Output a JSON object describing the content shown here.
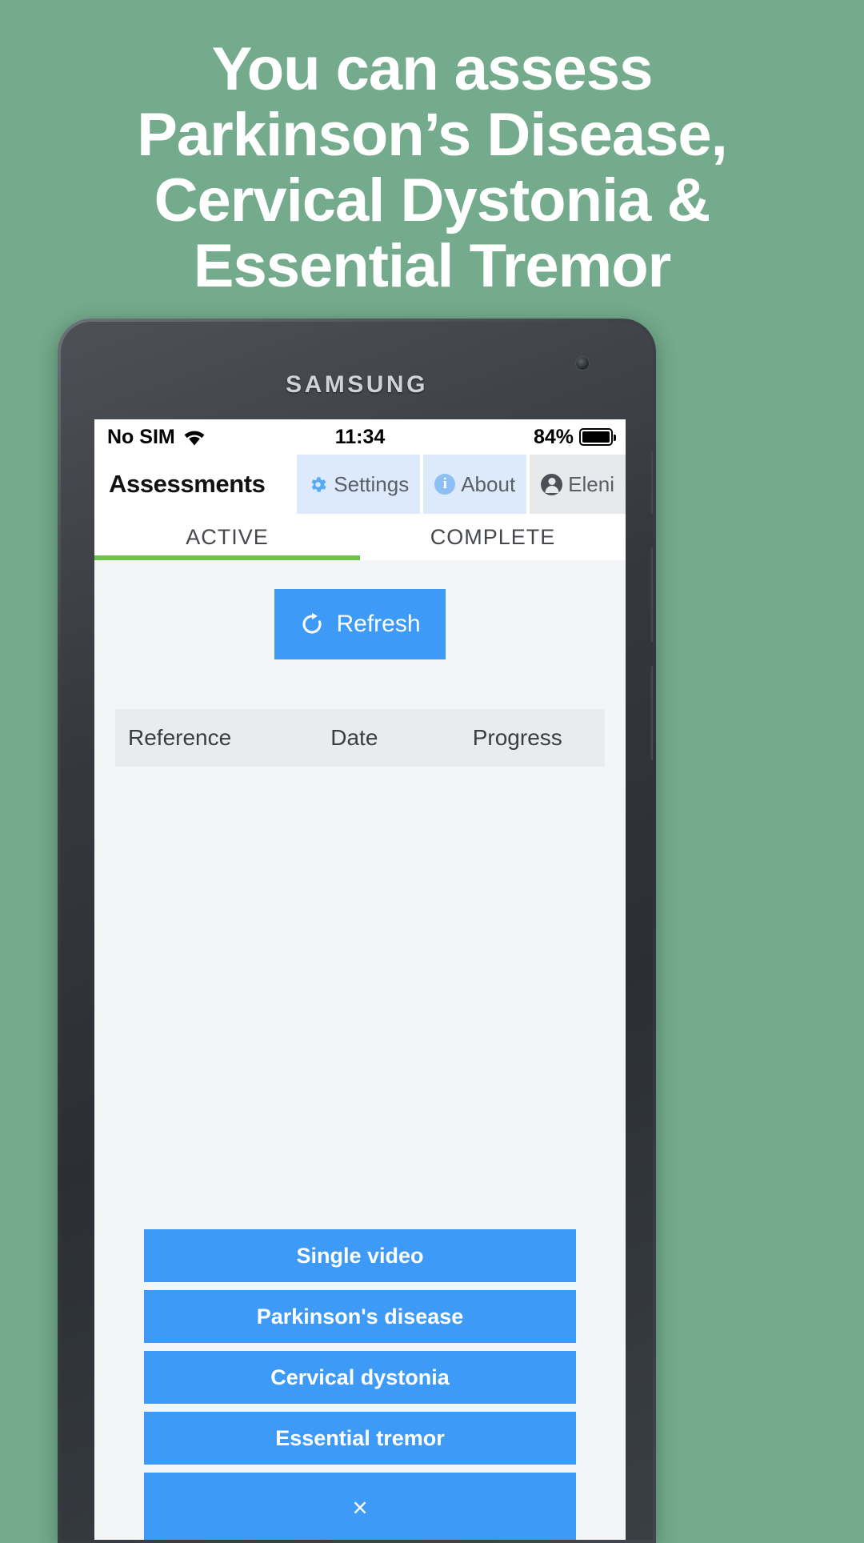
{
  "promo": {
    "background_color": "#74ab8c",
    "headline_lines": [
      "You can assess",
      "Parkinson’s Disease,",
      "Cervical Dystonia &",
      "Essential Tremor"
    ]
  },
  "device": {
    "brand": "SAMSUNG"
  },
  "status_bar": {
    "carrier": "No SIM",
    "wifi_icon": "wifi-icon",
    "time": "11:34",
    "battery_percent": "84%",
    "battery_icon": "battery-full-icon"
  },
  "app_bar": {
    "title": "Assessments",
    "actions": [
      {
        "label": "Settings",
        "icon": "gear-icon"
      },
      {
        "label": "About",
        "icon": "info-icon"
      },
      {
        "label": "Eleni",
        "icon": "person-icon"
      }
    ]
  },
  "tabs": {
    "items": [
      {
        "label": "ACTIVE",
        "active": true
      },
      {
        "label": "COMPLETE",
        "active": false
      }
    ],
    "indicator_color": "#6cc24a"
  },
  "toolbar": {
    "refresh_label": "Refresh",
    "refresh_icon": "refresh-icon"
  },
  "table": {
    "columns": [
      "Reference",
      "Date",
      "Progress"
    ],
    "rows": []
  },
  "action_sheet": {
    "buttons": [
      {
        "label": "Single video"
      },
      {
        "label": "Parkinson's disease"
      },
      {
        "label": "Cervical dystonia"
      },
      {
        "label": "Essential tremor"
      }
    ],
    "close_label": "×",
    "accent_color": "#3d9bf7"
  }
}
